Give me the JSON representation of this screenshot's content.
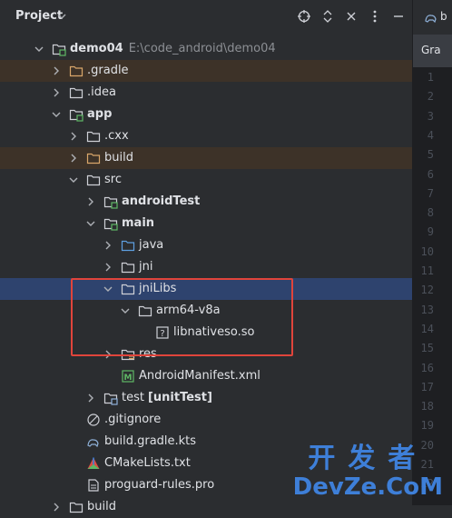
{
  "panel": {
    "title": "Project"
  },
  "editor": {
    "tab_partial": "b",
    "tab2_partial": "Gra",
    "line_numbers": [
      "1",
      "2",
      "3",
      "4",
      "5",
      "6",
      "7",
      "8",
      "9",
      "10",
      "11",
      "12",
      "13",
      "14",
      "15",
      "16",
      "17",
      "18",
      "19",
      "20",
      "21",
      "22"
    ]
  },
  "tree": [
    {
      "label": "demo04",
      "path": "E:\\code_android\\demo04",
      "bold": true,
      "icon": "folder-module-icon",
      "chevron": "down",
      "level": 0
    },
    {
      "label": ".gradle",
      "icon": "folder-excluded-icon",
      "chevron": "right",
      "level": 1,
      "highlight": "orange"
    },
    {
      "label": ".idea",
      "icon": "folder-icon",
      "chevron": "right",
      "level": 1
    },
    {
      "label": "app",
      "bold": true,
      "icon": "folder-module-icon",
      "chevron": "down",
      "level": 1
    },
    {
      "label": ".cxx",
      "icon": "folder-icon",
      "chevron": "right",
      "level": 2
    },
    {
      "label": "build",
      "icon": "folder-excluded-icon",
      "chevron": "right",
      "level": 2,
      "highlight": "orange"
    },
    {
      "label": "src",
      "icon": "folder-icon",
      "chevron": "down",
      "level": 2
    },
    {
      "label": "androidTest",
      "bold": true,
      "icon": "folder-test-source-icon",
      "chevron": "right",
      "level": 3
    },
    {
      "label": "main",
      "bold": true,
      "icon": "folder-source-root-icon",
      "chevron": "down",
      "level": 3
    },
    {
      "label": "java",
      "icon": "folder-java-source-icon",
      "chevron": "right",
      "level": 4
    },
    {
      "label": "jni",
      "icon": "folder-icon",
      "chevron": "right",
      "level": 4
    },
    {
      "label": "jniLibs",
      "icon": "folder-icon",
      "chevron": "down",
      "level": 4,
      "highlight": "blue"
    },
    {
      "label": "arm64-v8a",
      "icon": "folder-icon",
      "chevron": "down",
      "level": 5
    },
    {
      "label": "libnativeso.so",
      "icon": "unknown-file-icon",
      "chevron": "none",
      "level": 6
    },
    {
      "label": "res",
      "icon": "folder-resources-icon",
      "chevron": "right",
      "level": 4
    },
    {
      "label": "AndroidManifest.xml",
      "icon": "manifest-file-icon",
      "chevron": "none",
      "level": 4
    },
    {
      "label": "test",
      "suffix": "[unitTest]",
      "icon": "folder-test-icon",
      "chevron": "right",
      "level": 3
    },
    {
      "label": ".gitignore",
      "icon": "gitignore-icon",
      "chevron": "none",
      "level": 2
    },
    {
      "label": "build.gradle.kts",
      "icon": "gradle-file-icon",
      "chevron": "none",
      "level": 2
    },
    {
      "label": "CMakeLists.txt",
      "icon": "cmake-file-icon",
      "chevron": "none",
      "level": 2
    },
    {
      "label": "proguard-rules.pro",
      "icon": "text-file-icon",
      "chevron": "none",
      "level": 2
    },
    {
      "label": "build",
      "icon": "folder-icon",
      "chevron": "right",
      "level": 1
    }
  ],
  "watermark": {
    "line1": "开发者",
    "line2": "DevZe.CoM"
  },
  "colors": {
    "panel_bg": "#2b2d30",
    "editor_bg": "#1e1f22",
    "selection": "#2e436e",
    "excluded_bg": "#3d3228",
    "annotation_box": "#e0443b"
  }
}
